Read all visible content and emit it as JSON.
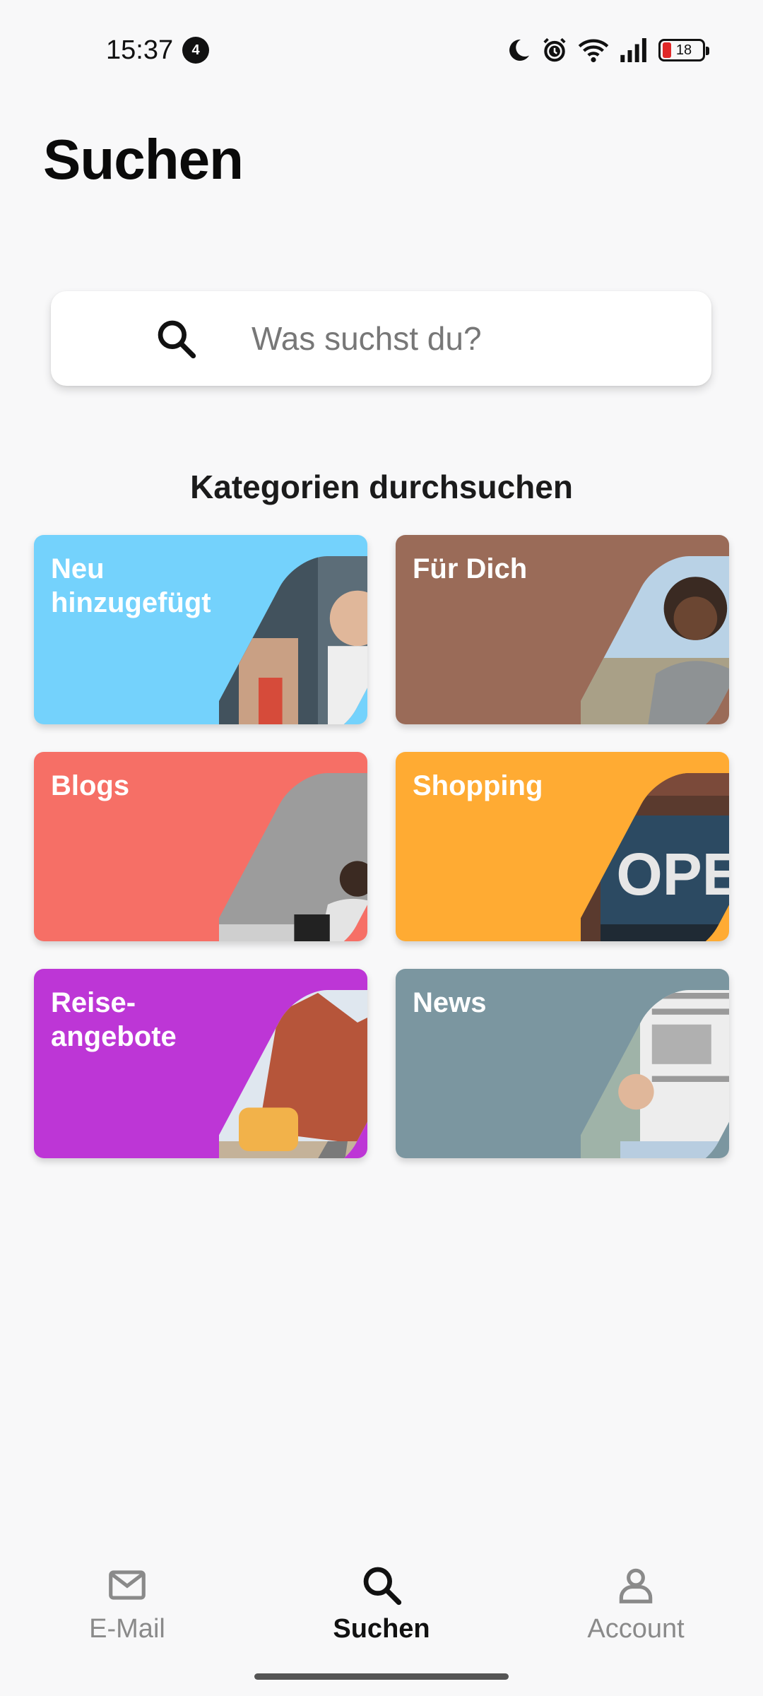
{
  "status_bar": {
    "time": "15:37",
    "notification_count": "4",
    "battery_level": "18",
    "battery_color": "#e02828"
  },
  "page": {
    "title": "Suchen"
  },
  "search": {
    "placeholder": "Was suchst du?",
    "icon": "search-icon"
  },
  "categories": {
    "heading": "Kategorien durchsuchen",
    "items": [
      {
        "label": "Neu\nhinzugefügt",
        "color": "#74d2fc"
      },
      {
        "label": "Für Dich",
        "color": "#9a6b58"
      },
      {
        "label": "Blogs",
        "color": "#f66f66"
      },
      {
        "label": "Shopping",
        "color": "#ffab33"
      },
      {
        "label": "Reise-\nangebote",
        "color": "#bd36d6"
      },
      {
        "label": "News",
        "color": "#7b96a0"
      }
    ]
  },
  "bottom_nav": {
    "items": [
      {
        "label": "E-Mail",
        "icon": "mail-icon",
        "active": false
      },
      {
        "label": "Suchen",
        "icon": "search-icon",
        "active": true
      },
      {
        "label": "Account",
        "icon": "person-icon",
        "active": false
      }
    ]
  }
}
